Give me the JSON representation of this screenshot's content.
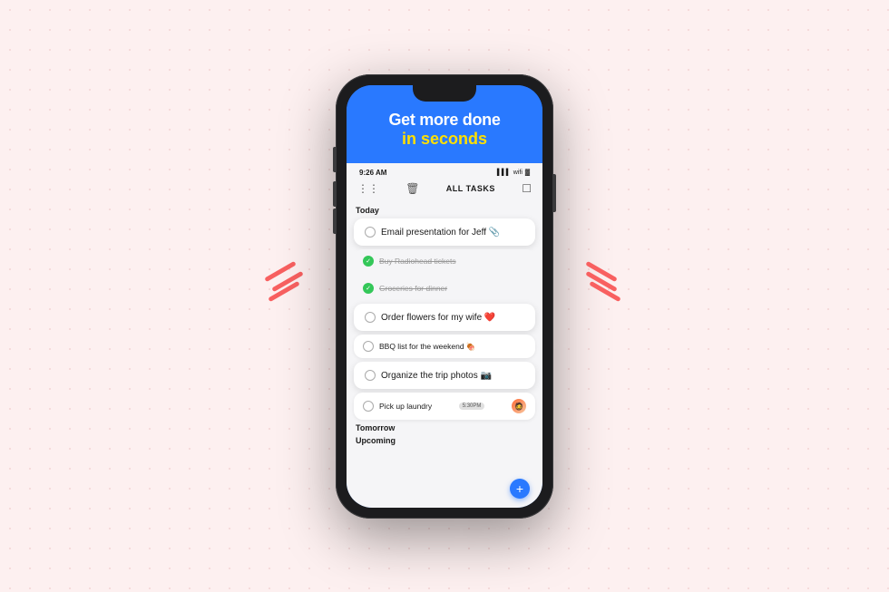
{
  "background": {
    "color": "#fdf0f0"
  },
  "phone": {
    "header": {
      "line1": "Get more done",
      "line2": "in seconds"
    },
    "statusBar": {
      "time": "9:26 AM"
    },
    "toolbar": {
      "title": "ALL TASKS"
    },
    "sections": [
      {
        "label": "Today",
        "tasks": [
          {
            "id": 1,
            "text": "Email presentation for Jeff 📎",
            "checked": false,
            "size": "large"
          },
          {
            "id": 2,
            "text": "Buy Radiohead tickets",
            "checked": true,
            "strikethrough": true
          },
          {
            "id": 3,
            "text": "Groceries for dinner",
            "checked": true,
            "strikethrough": true
          },
          {
            "id": 4,
            "text": "Order flowers for my wife ❤️",
            "checked": false,
            "size": "large"
          },
          {
            "id": 5,
            "text": "BBQ list for the weekend 🍖",
            "checked": false,
            "size": "small"
          },
          {
            "id": 6,
            "text": "Organize the trip photos 📷",
            "checked": false,
            "size": "large"
          },
          {
            "id": 7,
            "text": "Pick up laundry",
            "checked": false,
            "badge": "5:30PM",
            "hasAvatar": true
          }
        ]
      },
      {
        "label": "Tomorrow",
        "tasks": []
      },
      {
        "label": "Upcoming",
        "tasks": []
      }
    ],
    "fab": "+"
  },
  "decorations": {
    "slashColor": "#f86060"
  }
}
